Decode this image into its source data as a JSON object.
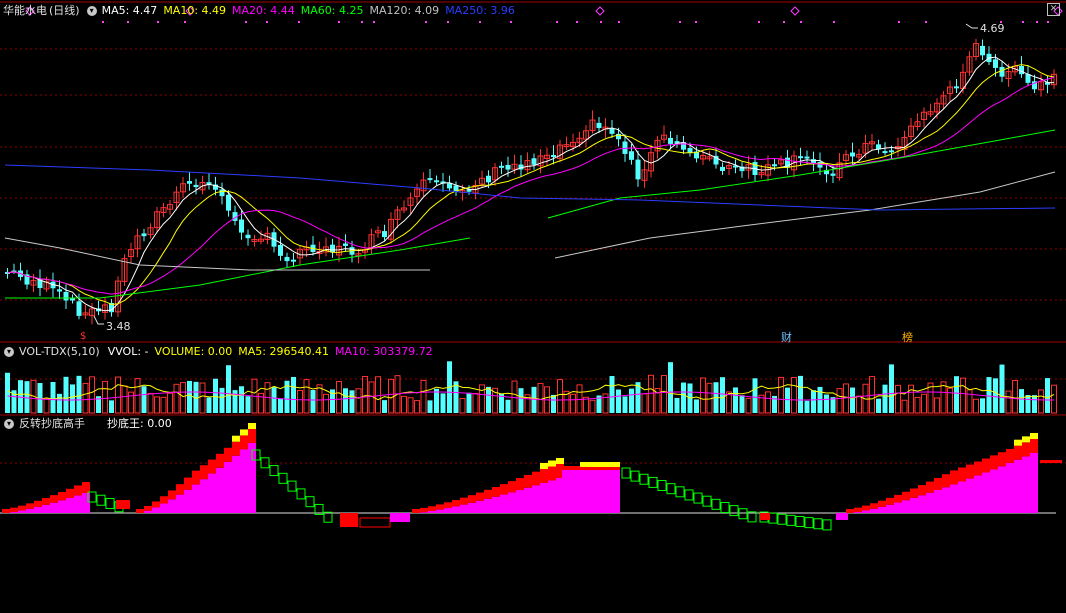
{
  "main_panel": {
    "stock_name": "华能水电",
    "period": "(日线)",
    "indicators": [
      {
        "text": "MA5: 4.47",
        "color": "#ffffff"
      },
      {
        "text": "MA10: 4.49",
        "color": "#ffff00"
      },
      {
        "text": "MA20: 4.44",
        "color": "#ff00ff"
      },
      {
        "text": "MA60: 4.25",
        "color": "#00ff00"
      },
      {
        "text": "MA120: 4.09",
        "color": "#c0c0c0"
      },
      {
        "text": "MA250: 3.96",
        "color": "#2b3cff"
      }
    ],
    "high_marker": "4.69",
    "low_marker": "3.48",
    "event_badges": [
      {
        "text": "财",
        "color": "#6fc3ff",
        "kind": "report-badge"
      },
      {
        "text": "榜",
        "color": "#ffb000",
        "kind": "list-badge"
      }
    ],
    "dividend_marker": "$"
  },
  "volume_panel": {
    "name": "VOL-TDX(5,10)",
    "indicators": [
      {
        "text": "VVOL: -",
        "color": "#ffffff"
      },
      {
        "text": "VOLUME: 0.00",
        "color": "#ffff00"
      },
      {
        "text": "MA5: 296540.41",
        "color": "#ffff00"
      },
      {
        "text": "MA10: 303379.72",
        "color": "#ff00ff"
      }
    ]
  },
  "indicator_panel": {
    "name": "反转抄底高手",
    "indicators": [
      {
        "text": "抄底王: 0.00",
        "color": "#ffffff"
      }
    ]
  },
  "colors": {
    "up": "#ff3232",
    "down": "#54ffff",
    "grid": "#8b0000",
    "magenta": "#ff00ff",
    "red_fill": "#ff0000",
    "yellow_fill": "#ffff00",
    "green_outline": "#00ff00"
  },
  "close_icon": "close-icon"
}
